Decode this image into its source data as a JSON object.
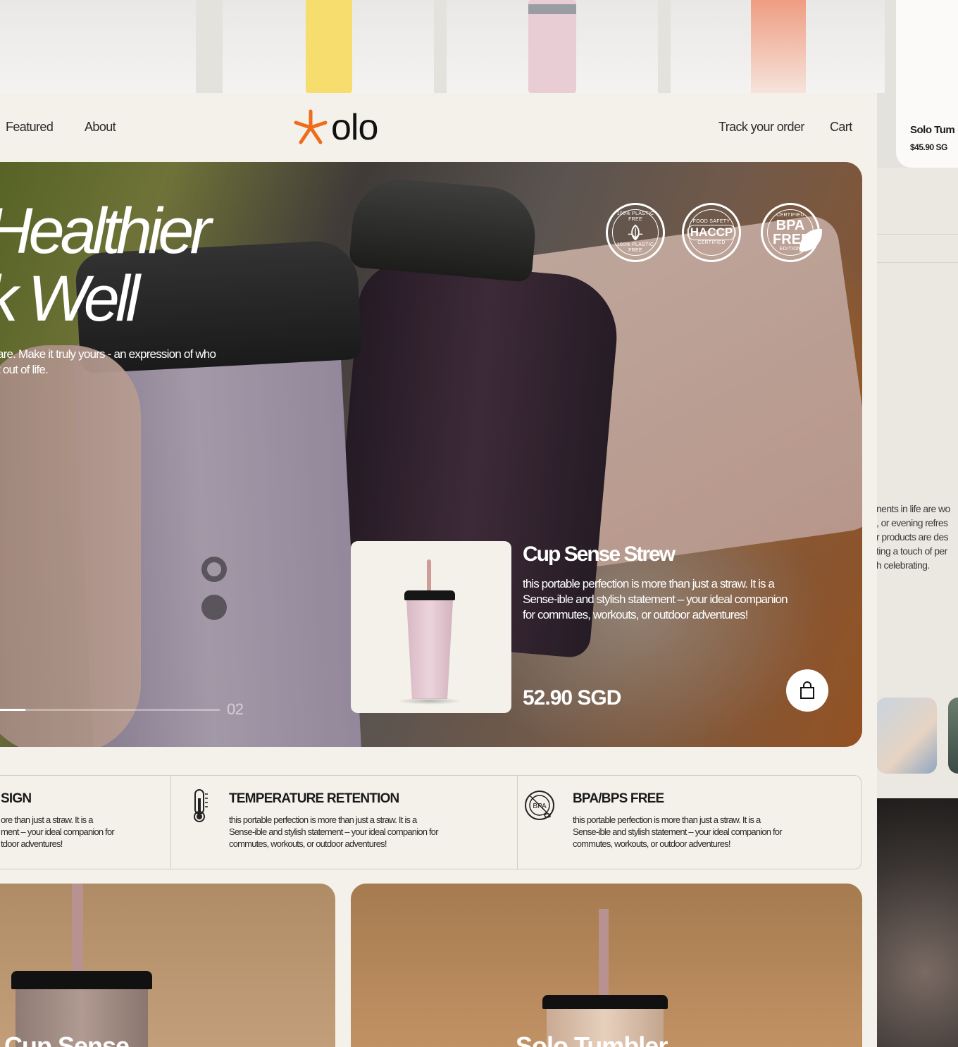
{
  "top_strip": {
    "side_card": {
      "name": "Solo Tum",
      "price": "$45.90 SG"
    }
  },
  "side_panel": {
    "text_lines": [
      "nents in life are wo",
      ", or evening refres",
      "r products are des",
      "ting a touch of per",
      "h celebrating."
    ]
  },
  "nav": {
    "left_links": [
      "Featured",
      "About"
    ],
    "logo_text": "olo",
    "right_links": [
      "Track your order",
      "Cart"
    ],
    "brand_color": "#ef6c1a"
  },
  "hero": {
    "title_lines": [
      "Healthier",
      "k Well"
    ],
    "description_lines": [
      "are. Make it truly yours - an expression of who",
      "t out of life."
    ],
    "badges": [
      {
        "top": "100% PLASTIC FREE",
        "main": "",
        "bottom": "100% PLASTIC FREE",
        "icon": "leaf-icon"
      },
      {
        "top": "FOOD SAFETY",
        "main": "HACCP",
        "bottom": "CERTIFIED"
      },
      {
        "top": "CERTIFIED",
        "main": "BPA FREE",
        "bottom": "EDITION"
      }
    ],
    "slide_number": "02",
    "slide_progress": 0.115,
    "product": {
      "title": "Cup Sense Strew",
      "description_lines": [
        "this portable perfection is more than just a straw. It is a",
        "Sense-ible and stylish statement – your ideal companion",
        "for commutes, workouts, or outdoor adventures!"
      ],
      "price": "52.90 SGD"
    }
  },
  "features": [
    {
      "title": "SIGN",
      "icon": "",
      "text_lines": [
        "ore than just a straw. It is a",
        "ment – your ideal companion for",
        "tdoor adventures!"
      ]
    },
    {
      "title": "TEMPERATURE RETENTION",
      "icon": "thermometer-icon",
      "text_lines": [
        "this portable perfection is more than just a straw. It is a",
        "Sense-ible and stylish statement – your ideal companion for",
        "commutes, workouts, or outdoor adventures!"
      ]
    },
    {
      "title": "BPA/BPS FREE",
      "icon": "bpa-free-icon",
      "icon_text": "BPA",
      "text_lines": [
        "this portable perfection is more than just a straw. It is a",
        "Sense-ible and stylish statement – your ideal companion for",
        "commutes, workouts, or outdoor adventures!"
      ]
    }
  ],
  "tiles": [
    {
      "name": "Cup Sense"
    },
    {
      "name": "Solo Tumbler"
    }
  ]
}
